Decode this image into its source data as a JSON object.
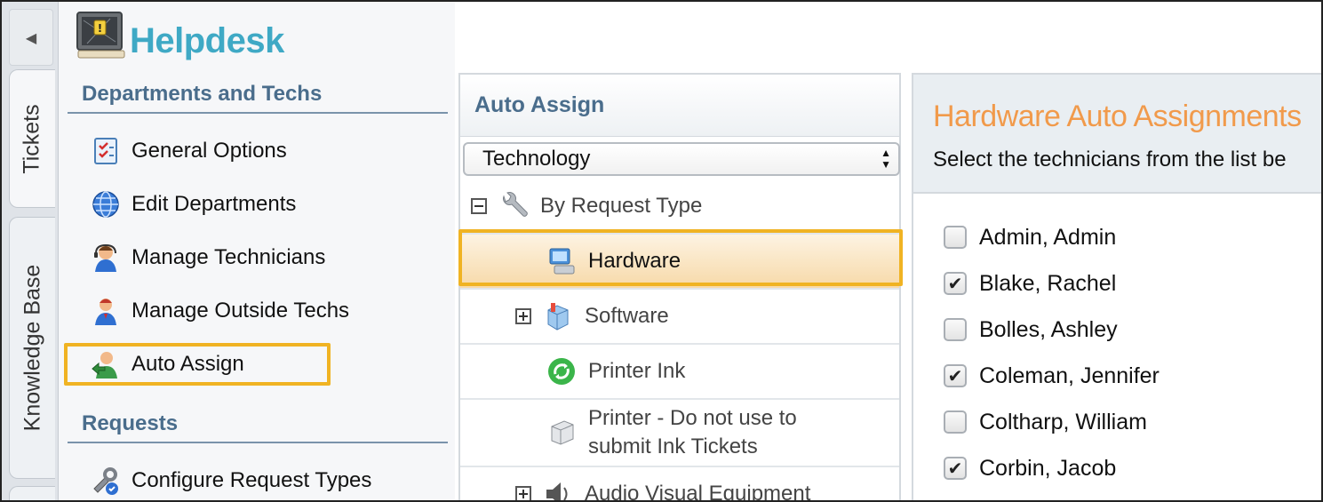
{
  "vertical_tabs": [
    {
      "label": "Tickets"
    },
    {
      "label": "Knowledge Base"
    }
  ],
  "app": {
    "title": "Helpdesk"
  },
  "sections": {
    "departments": {
      "title": "Departments and Techs",
      "items": [
        {
          "label": "General Options",
          "icon": "checklist-icon"
        },
        {
          "label": "Edit Departments",
          "icon": "globe-icon"
        },
        {
          "label": "Manage Technicians",
          "icon": "technician-icon"
        },
        {
          "label": "Manage Outside Techs",
          "icon": "outside-tech-icon"
        },
        {
          "label": "Auto Assign",
          "icon": "auto-assign-icon"
        }
      ]
    },
    "requests": {
      "title": "Requests",
      "items": [
        {
          "label": "Configure Request Types",
          "icon": "configure-icon"
        }
      ]
    }
  },
  "auto_assign": {
    "title": "Auto Assign",
    "category_select": "Technology",
    "tree": [
      {
        "label": "By Request Type",
        "icon": "wrench-icon",
        "toggle": "collapse"
      },
      {
        "label": "Hardware",
        "icon": "computer-icon",
        "selected": true
      },
      {
        "label": "Software",
        "icon": "software-icon",
        "toggle": "expand"
      },
      {
        "label": "Printer Ink",
        "icon": "recycle-icon"
      },
      {
        "label_line1": "Printer - Do not use to",
        "label_line2": "submit Ink Tickets",
        "icon": "printer-icon"
      },
      {
        "label": "Audio Visual Equipment",
        "icon": "speaker-icon",
        "toggle": "expand"
      }
    ]
  },
  "assignments": {
    "title": "Hardware Auto Assignments",
    "subtitle": "Select the technicians from the list be",
    "technicians": [
      {
        "name": "Admin, Admin",
        "checked": false
      },
      {
        "name": "Blake, Rachel",
        "checked": true
      },
      {
        "name": "Bolles, Ashley",
        "checked": false
      },
      {
        "name": "Coleman, Jennifer",
        "checked": true
      },
      {
        "name": "Coltharp, William",
        "checked": false
      },
      {
        "name": "Corbin, Jacob",
        "checked": true
      }
    ]
  },
  "colors": {
    "brand": "#3fa9c5",
    "section_heading": "#4a6d8c",
    "assignment_title": "#f19a4b",
    "highlight": "#f0b323"
  }
}
